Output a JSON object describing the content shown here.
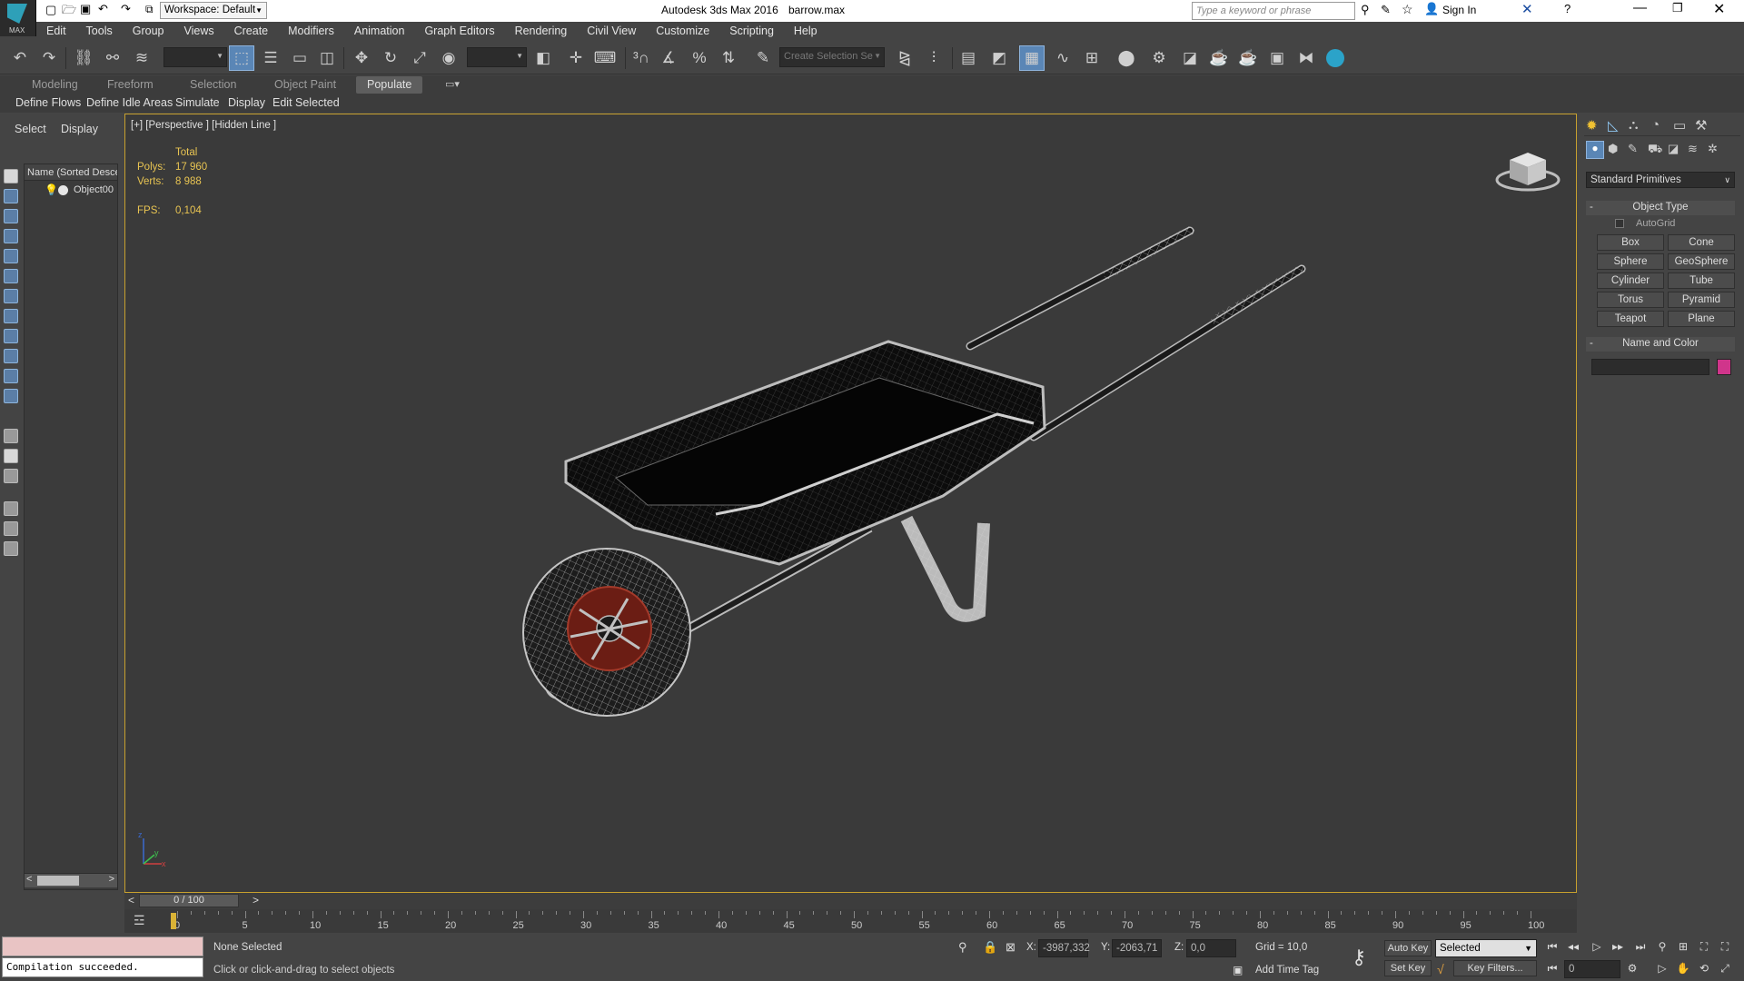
{
  "window": {
    "workspace_label": "Workspace: Default",
    "title_app": "Autodesk 3ds Max 2016",
    "title_file": "barrow.max",
    "search_placeholder": "Type a keyword or phrase",
    "sign_in": "Sign In",
    "logo_text": "MAX"
  },
  "menu": [
    "Edit",
    "Tools",
    "Group",
    "Views",
    "Create",
    "Modifiers",
    "Animation",
    "Graph Editors",
    "Rendering",
    "Civil View",
    "Customize",
    "Scripting",
    "Help"
  ],
  "toolbar": {
    "selection_set_placeholder": "Create Selection Se",
    "filter_value": "",
    "view_value": ""
  },
  "ribbon": {
    "tabs": [
      "Modeling",
      "Freeform",
      "Selection",
      "Object Paint",
      "Populate"
    ],
    "active": "Populate",
    "populate_items": [
      "Define Flows",
      "Define Idle Areas",
      "Simulate",
      "Display",
      "Edit Selected"
    ]
  },
  "scene_explorer": {
    "tabs": [
      "Select",
      "Display"
    ],
    "column_header": "Name (Sorted Desce",
    "items": [
      "Object00"
    ]
  },
  "viewport": {
    "label": "[+] [Perspective ] [Hidden Line ]",
    "stats": {
      "total_label": "Total",
      "polys_label": "Polys:",
      "polys": "17 960",
      "verts_label": "Verts:",
      "verts": "8 988",
      "fps_label": "FPS:",
      "fps": "0,104"
    },
    "axis": {
      "x": "x",
      "y": "y",
      "z": "z"
    }
  },
  "command_panel": {
    "dropdown": "Standard Primitives",
    "object_type_title": "Object Type",
    "autogrid": "AutoGrid",
    "buttons": [
      "Box",
      "Cone",
      "Sphere",
      "GeoSphere",
      "Cylinder",
      "Tube",
      "Torus",
      "Pyramid",
      "Teapot",
      "Plane"
    ],
    "name_color_title": "Name and Color",
    "name_value": "",
    "color": "#d0358b"
  },
  "timeline": {
    "slider_label": "0 / 100",
    "ticks": [
      "0",
      "5",
      "10",
      "15",
      "20",
      "25",
      "30",
      "35",
      "40",
      "45",
      "50",
      "55",
      "60",
      "65",
      "70",
      "75",
      "80",
      "85",
      "90",
      "95",
      "100"
    ]
  },
  "status": {
    "maxscript_output": "Compilation succeeded.",
    "selection_status": "None Selected",
    "prompt": "Click or click-and-drag to select objects",
    "x_label": "X:",
    "x": "-3987,332",
    "y_label": "Y:",
    "y": "-2063,71",
    "z_label": "Z:",
    "z": "0,0",
    "grid": "Grid = 10,0",
    "add_time_tag": "Add Time Tag",
    "auto_key": "Auto Key",
    "set_key": "Set Key",
    "key_mode": "Selected",
    "key_filters": "Key Filters...",
    "frame": "0"
  }
}
